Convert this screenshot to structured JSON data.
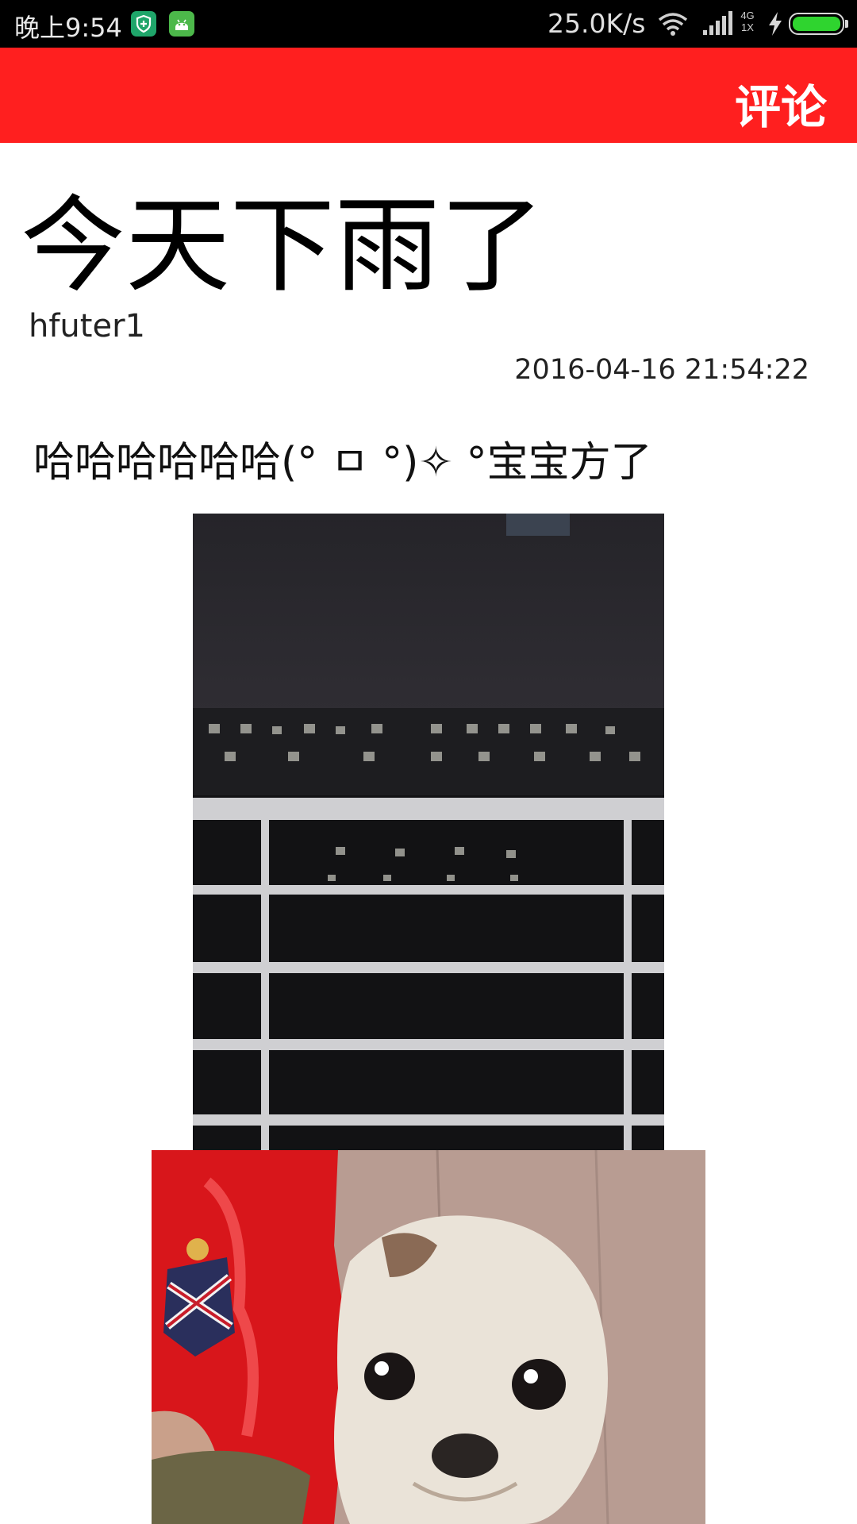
{
  "status_bar": {
    "time": "晚上9:54",
    "network_speed": "25.0K/s",
    "network_type_top": "4G",
    "network_type_bottom": "1X",
    "battery_level": 1.0,
    "icons": [
      "shield-app-icon",
      "android-app-icon",
      "wifi-icon",
      "signal-icon",
      "charging-icon",
      "battery-icon"
    ]
  },
  "app_bar": {
    "action_label": "评论",
    "color": "#ff1f1f"
  },
  "post": {
    "title": "今天下雨了",
    "author": "hfuter1",
    "date": "2016-04-16 21:54:22",
    "body": "哈哈哈哈哈哈(° ㅁ °)✧ °宝宝方了",
    "images": [
      "night-balcony-photo",
      "surprised-dog-photo"
    ]
  }
}
